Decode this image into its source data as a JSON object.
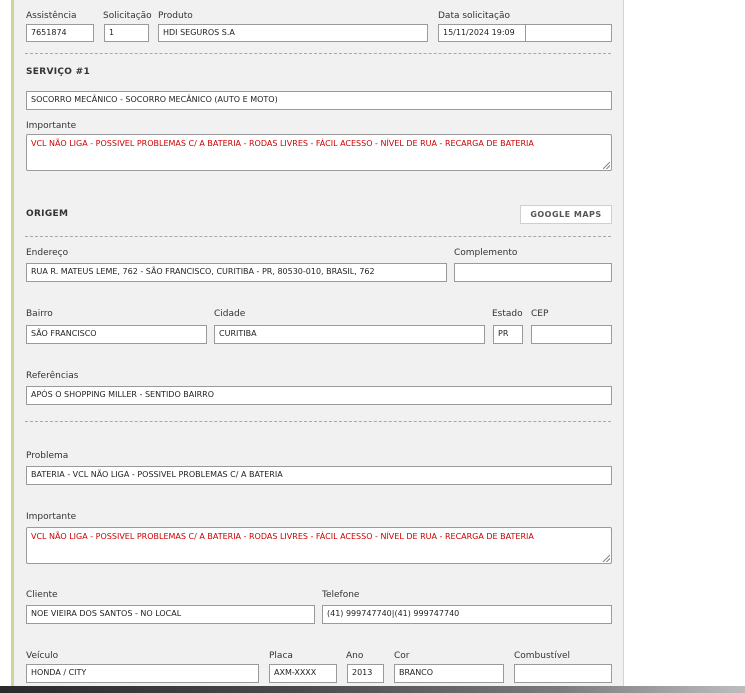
{
  "header": {
    "assistencia_label": "Assistência",
    "assistencia_value": "7651874",
    "solicitacao_label": "Solicitação",
    "solicitacao_value": "1",
    "produto_label": "Produto",
    "produto_value": "HDI SEGUROS S.A",
    "data_label": "Data solicitação",
    "data_value": "15/11/2024 19:09",
    "data_extra_value": ""
  },
  "servico": {
    "title": "SERVIÇO #1",
    "value": "SOCORRO MECÂNICO - SOCORRO MECÂNICO (AUTO E MOTO)",
    "importante_label": "Importante",
    "importante_value": "VCL NÃO LIGA - POSSIVEL PROBLEMAS C/ A BATERIA - RODAS LIVRES - FÁCIL ACESSO - NÍVEL DE RUA - RECARGA DE BATERIA"
  },
  "origem": {
    "title": "ORIGEM",
    "maps_button": "GOOGLE MAPS",
    "endereco_label": "Endereço",
    "endereco_value": "RUA R. MATEUS LEME, 762 - SÃO FRANCISCO, CURITIBA - PR, 80530-010, BRASIL, 762",
    "complemento_label": "Complemento",
    "complemento_value": "",
    "bairro_label": "Bairro",
    "bairro_value": "SÃO FRANCISCO",
    "cidade_label": "Cidade",
    "cidade_value": "CURITIBA",
    "estado_label": "Estado",
    "estado_value": "PR",
    "cep_label": "CEP",
    "cep_value": "",
    "referencias_label": "Referências",
    "referencias_value": "APÓS O SHOPPING MILLER - SENTIDO BAIRRO"
  },
  "problema": {
    "label": "Problema",
    "value": "BATERIA - VCL NÃO LIGA - POSSIVEL PROBLEMAS C/ A BATERIA",
    "importante_label": "Importante",
    "importante_value": "VCL NÃO LIGA - POSSIVEL PROBLEMAS C/ A BATERIA - RODAS LIVRES - FÁCIL ACESSO - NÍVEL DE RUA - RECARGA DE BATERIA"
  },
  "cliente": {
    "cliente_label": "Cliente",
    "cliente_value": "NOE VIEIRA DOS SANTOS - NO LOCAL",
    "telefone_label": "Telefone",
    "telefone_value": "(41) 999747740|(41) 999747740"
  },
  "veiculo": {
    "veiculo_label": "Veículo",
    "veiculo_value": "HONDA / CITY",
    "placa_label": "Placa",
    "placa_value": "AXM-XXXX",
    "ano_label": "Ano",
    "ano_value": "2013",
    "cor_label": "Cor",
    "cor_value": "BRANCO",
    "combustivel_label": "Combustível",
    "combustivel_value": ""
  }
}
